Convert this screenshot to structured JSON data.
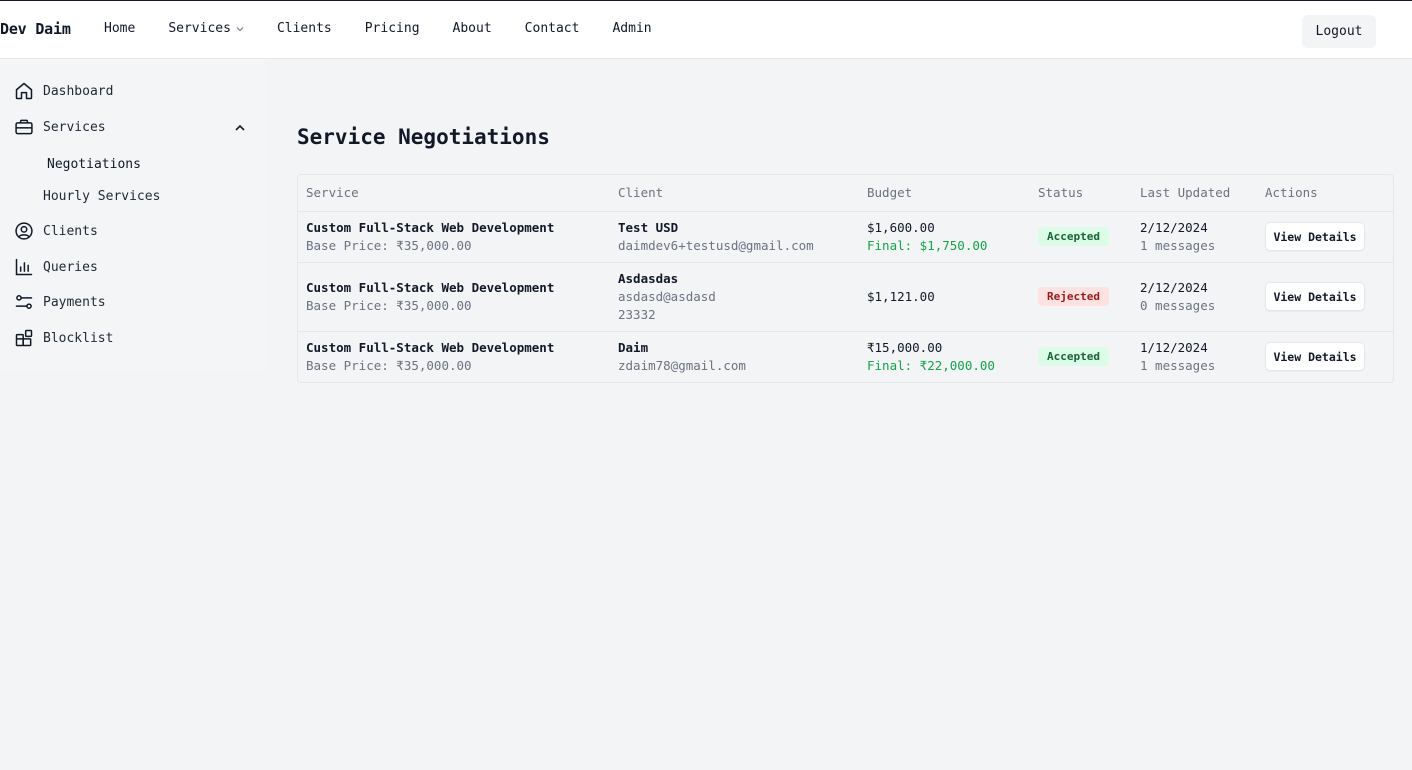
{
  "header": {
    "brand": "Dev Daim",
    "nav": [
      "Home",
      "Services",
      "Clients",
      "Pricing",
      "About",
      "Contact",
      "Admin"
    ],
    "logout_label": "Logout"
  },
  "sidebar": {
    "items": [
      {
        "label": "Dashboard",
        "icon": "home-icon"
      },
      {
        "label": "Services",
        "icon": "briefcase-icon"
      },
      {
        "label": "Clients",
        "icon": "user-circle-icon"
      },
      {
        "label": "Queries",
        "icon": "bar-chart-icon"
      },
      {
        "label": "Payments",
        "icon": "sliders-icon"
      },
      {
        "label": "Blocklist",
        "icon": "blocks-icon"
      }
    ],
    "services_sub": [
      "Negotiations",
      "Hourly Services"
    ]
  },
  "main": {
    "title": "Service Negotiations",
    "columns": [
      "Service",
      "Client",
      "Budget",
      "Status",
      "Last Updated",
      "Actions"
    ],
    "rows": [
      {
        "service": "Custom Full-Stack Web Development",
        "base_price": "Base Price: ₹35,000.00",
        "client_name": "Test USD",
        "client_email": "daimdev6+testusd@gmail.com",
        "client_extra": "",
        "budget": "$1,600.00",
        "final": "Final: $1,750.00",
        "status": "Accepted",
        "date": "2/12/2024",
        "messages": "1 messages",
        "action": "View Details"
      },
      {
        "service": "Custom Full-Stack Web Development",
        "base_price": "Base Price: ₹35,000.00",
        "client_name": "Asdasdas",
        "client_email": "asdasd@asdasd",
        "client_extra": "23332",
        "budget": "$1,121.00",
        "final": "",
        "status": "Rejected",
        "date": "2/12/2024",
        "messages": "0 messages",
        "action": "View Details"
      },
      {
        "service": "Custom Full-Stack Web Development",
        "base_price": "Base Price: ₹35,000.00",
        "client_name": "Daim",
        "client_email": "zdaim78@gmail.com",
        "client_extra": "",
        "budget": "₹15,000.00",
        "final": "Final: ₹22,000.00",
        "status": "Accepted",
        "date": "1/12/2024",
        "messages": "1 messages",
        "action": "View Details"
      }
    ]
  },
  "colors": {
    "accepted_bg": "#dcfce7",
    "accepted_text": "#166534",
    "rejected_bg": "#fee2e2",
    "rejected_text": "#991b1b",
    "final_green": "#16a34a"
  }
}
